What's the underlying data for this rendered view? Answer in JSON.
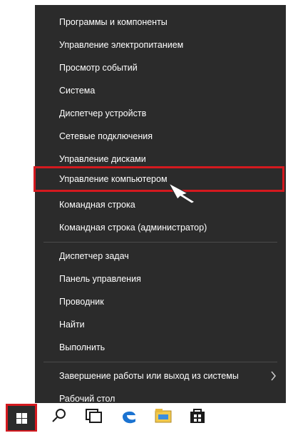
{
  "menu": {
    "items": [
      "Программы и компоненты",
      "Управление электропитанием",
      "Просмотр событий",
      "Система",
      "Диспетчер устройств",
      "Сетевые подключения",
      "Управление дисками",
      "Управление компьютером",
      "Командная строка",
      "Командная строка (администратор)",
      "Диспетчер задач",
      "Панель управления",
      "Проводник",
      "Найти",
      "Выполнить",
      "Завершение работы или выход из системы",
      "Рабочий стол"
    ]
  },
  "colors": {
    "menu_bg": "#2b2b2b",
    "highlight": "#d4191f",
    "text": "#ffffff"
  },
  "icons": [
    "windows-logo-icon",
    "search-icon",
    "task-view-icon",
    "edge-icon",
    "file-explorer-icon",
    "store-icon",
    "chevron-right-icon",
    "cursor-icon"
  ]
}
